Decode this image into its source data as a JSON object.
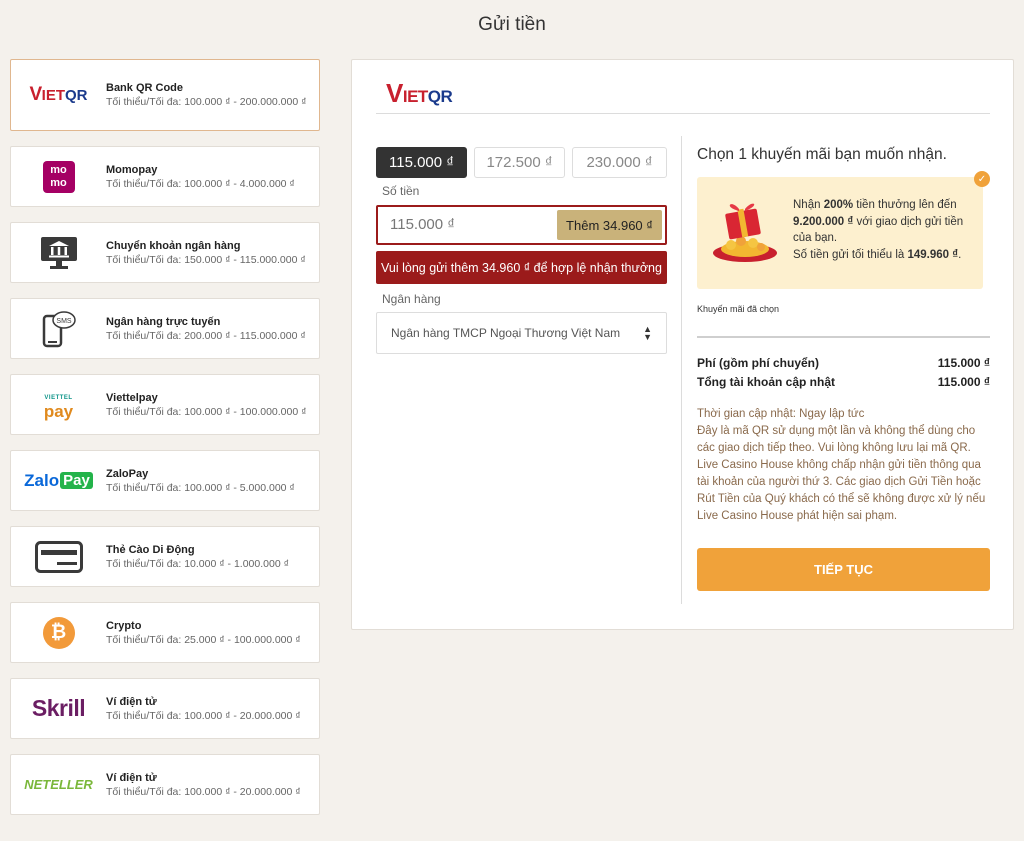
{
  "page_title": "Gửi tiền",
  "methods": [
    {
      "name": "Bank QR Code",
      "range": "Tối thiểu/Tối đa: 100.000 ₫ - 200.000.000 ₫",
      "logo": "vietqr-logo",
      "logo_text": "VIETQR"
    },
    {
      "name": "Momopay",
      "range": "Tối thiểu/Tối đa: 100.000 ₫ - 4.000.000 ₫",
      "logo": "momo-logo",
      "logo_text": "mo mo"
    },
    {
      "name": "Chuyển khoản ngân hàng",
      "range": "Tối thiểu/Tối đa: 150.000 ₫ - 115.000.000 ₫",
      "logo": "bank-transfer-icon"
    },
    {
      "name": "Ngân hàng trực tuyến",
      "range": "Tối thiểu/Tối đa: 200.000 ₫ - 115.000.000 ₫",
      "logo": "sms-phone-icon",
      "logo_text": "SMS"
    },
    {
      "name": "Viettelpay",
      "range": "Tối thiểu/Tối đa: 100.000 ₫ - 100.000.000 ₫",
      "logo": "viettelpay-logo",
      "logo_text": "VIETTEL",
      "logo_text2": "pay"
    },
    {
      "name": "ZaloPay",
      "range": "Tối thiểu/Tối đa: 100.000 ₫ - 5.000.000 ₫",
      "logo": "zalopay-logo",
      "logo_text": "Zalo",
      "logo_text2": "Pay"
    },
    {
      "name": "Thẻ Cào Di Động",
      "range": "Tối thiểu/Tối đa: 10.000 ₫ - 1.000.000 ₫",
      "logo": "card-icon"
    },
    {
      "name": "Crypto",
      "range": "Tối thiểu/Tối đa: 25.000 ₫ - 100.000.000 ₫",
      "logo": "bitcoin-icon",
      "logo_text": "₿"
    },
    {
      "name": "Ví điện tử",
      "range": "Tối thiểu/Tối đa: 100.000 ₫ - 20.000.000 ₫",
      "logo": "skrill-logo",
      "logo_text": "Skrill"
    },
    {
      "name": "Ví điện tử",
      "range": "Tối thiểu/Tối đa: 100.000 ₫ - 20.000.000 ₫",
      "logo": "neteller-logo",
      "logo_text": "NETELLER"
    }
  ],
  "panel": {
    "logo_v": "V",
    "logo_rest": "IET",
    "logo_qr": "QR",
    "amount_options": [
      "115.000 ₫",
      "172.500 ₫",
      "230.000 ₫"
    ],
    "amount_label": "Số tiền",
    "amount_value": "115.000 ₫",
    "add_button": "Thêm 34.960 ₫",
    "warning": "Vui lòng gửi thêm 34.960 ₫ để hợp lệ nhận thưởng",
    "bank_label": "Ngân hàng",
    "bank_value": "Ngân hàng TMCP Ngoại Thương Việt Nam"
  },
  "promo": {
    "title": "Chọn 1 khuyến mãi bạn muốn nhận.",
    "line1_pre": "Nhận ",
    "line1_bold": "200%",
    "line1_post": " tiền thưởng lên đến",
    "line2_bold": "9.200.000 ₫",
    "line2_post": " với giao dịch gửi tiền của bạn.",
    "line3_pre": "Số tiền gửi tối thiểu là ",
    "line3_bold": "149.960 ₫",
    "line3_post": ".",
    "selected_label": "Khuyến mãi đã chọn"
  },
  "fees": {
    "fee_label": "Phí (gồm phí chuyển)",
    "fee_value": "115.000 ₫",
    "total_label": "Tổng tài khoản cập nhật",
    "total_value": "115.000 ₫"
  },
  "info_text": "Thời gian cập nhật: Ngay lập tức\nĐây là mã QR sử dụng một lần và không thể dùng cho các giao dịch tiếp theo. Vui lòng không lưu lại mã QR.\nLive Casino House không chấp nhận gửi tiền thông qua tài khoản của người thứ 3. Các giao dịch Gửi Tiền hoặc Rút Tiền của Quý khách có thể sẽ không được xử lý nếu Live Casino House phát hiện sai phạm.",
  "continue_button": "TIẾP TỤC",
  "colors": {
    "accent": "#f0a23a",
    "danger": "#9b1b1b",
    "gold": "#c9b27a",
    "background": "#f4f1ec"
  }
}
